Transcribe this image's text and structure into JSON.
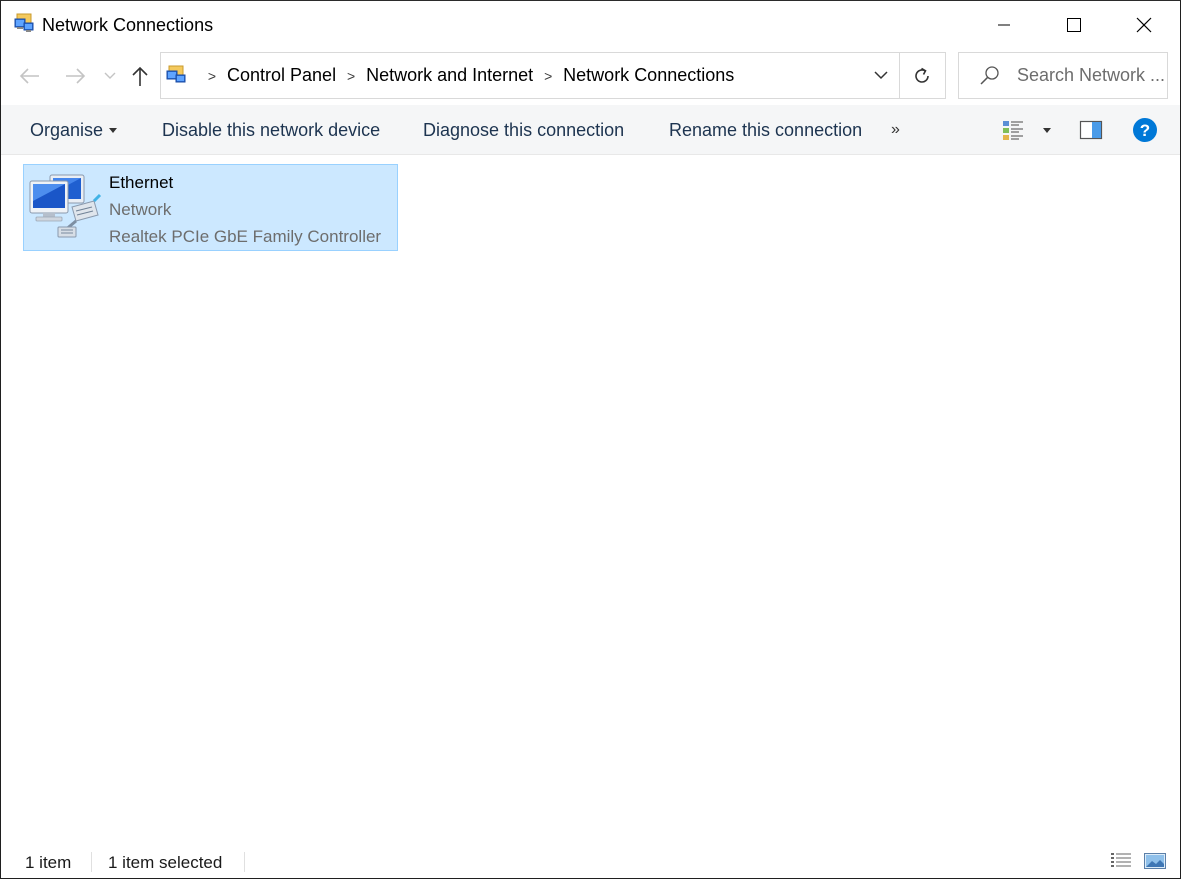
{
  "window": {
    "title": "Network Connections",
    "title_icon": "network-connections-icon",
    "controls": {
      "minimize": "minimize-icon",
      "maximize": "maximize-icon",
      "close": "close-icon"
    }
  },
  "navigation": {
    "back_icon": "arrow-left-icon",
    "forward_icon": "arrow-right-icon",
    "recent_icon": "chevron-down-icon",
    "up_icon": "arrow-up-icon"
  },
  "address": {
    "icon": "control-panel-network-icon",
    "breadcrumbs": [
      "Control Panel",
      "Network and Internet",
      "Network Connections"
    ],
    "separator": ">"
  },
  "search": {
    "placeholder": "Search Network ..."
  },
  "commands": {
    "organise": "Organise",
    "disable": "Disable this network device",
    "diagnose": "Diagnose this connection",
    "rename": "Rename this connection",
    "more": "»"
  },
  "items": [
    {
      "name": "Ethernet",
      "status": "Network",
      "device": "Realtek PCIe GbE Family Controller",
      "selected": true,
      "icon": "ethernet-adapter-icon"
    }
  ],
  "statusbar": {
    "count": "1 item",
    "selection": "1 item selected"
  },
  "colors": {
    "selection_bg": "#cce8ff",
    "selection_border": "#99d1ff",
    "command_bar_bg": "#f5f6f7",
    "help_blue": "#0078d7"
  }
}
